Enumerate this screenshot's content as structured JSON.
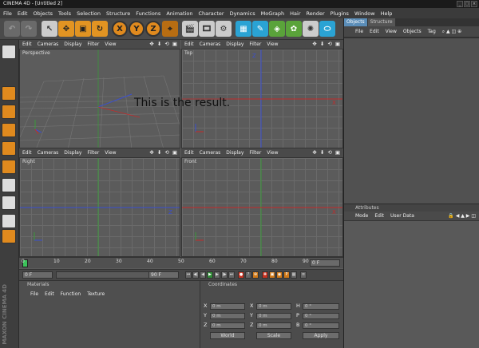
{
  "window": {
    "title": "CINEMA 4D - [Untitled 2]"
  },
  "menubar": [
    "File",
    "Edit",
    "Objects",
    "Tools",
    "Selection",
    "Structure",
    "Functions",
    "Animation",
    "Character",
    "Dynamics",
    "MoGraph",
    "Hair",
    "Render",
    "Plugins",
    "Window",
    "Help"
  ],
  "toolbar": {
    "x_label": "X",
    "y_label": "Y",
    "z_label": "Z"
  },
  "viewport_menu": [
    "Edit",
    "Cameras",
    "Display",
    "Filter",
    "View"
  ],
  "viewport_ctrl": "✥ ⬇ ⟲ ▣",
  "viewports": {
    "perspective": "Perspective",
    "top": "Top",
    "right": "Right",
    "front": "Front"
  },
  "overlay_text": "This is the result.",
  "axes": {
    "x": "X",
    "y": "Y",
    "z": "Z"
  },
  "objects_panel": {
    "tabs": [
      "Objects",
      "Structure"
    ],
    "menu": [
      "File",
      "Edit",
      "View",
      "Objects",
      "Tag"
    ]
  },
  "attributes_panel": {
    "title": "Attributes",
    "menu": [
      "Mode",
      "Edit",
      "User Data"
    ]
  },
  "timeline": {
    "ticks": [
      "0",
      "10",
      "20",
      "30",
      "40",
      "50",
      "60",
      "70",
      "80",
      "90"
    ],
    "frame_field": "0 F"
  },
  "transport": {
    "start_field": "0 F",
    "end_field": "90 F",
    "mid_field": "90 F"
  },
  "materials": {
    "title": "Materials",
    "menu": [
      "File",
      "Edit",
      "Function",
      "Texture"
    ]
  },
  "coordinates": {
    "title": "Coordinates",
    "labels_left": [
      "X",
      "Y",
      "Z"
    ],
    "labels_mid": [
      "X",
      "Y",
      "Z"
    ],
    "labels_right": [
      "H",
      "P",
      "B"
    ],
    "pos_values": [
      "0 m",
      "0 m",
      "0 m"
    ],
    "size_values": [
      "0 m",
      "0 m",
      "0 m"
    ],
    "rot_values": [
      "0 °",
      "0 °",
      "0 °"
    ],
    "mode_world": "World",
    "mode_scale": "Scale",
    "apply_label": "Apply"
  },
  "branding": {
    "logo": "MAXON CINEMA 4D"
  }
}
